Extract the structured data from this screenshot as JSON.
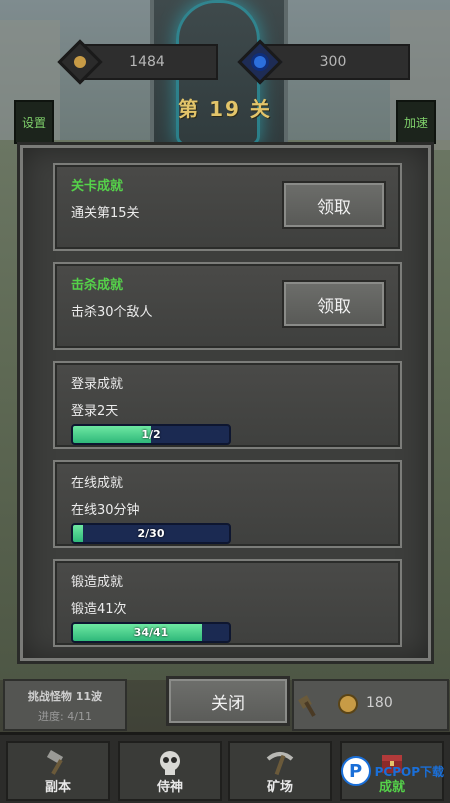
{
  "resources": {
    "gold": "1484",
    "gems": "300"
  },
  "stage": {
    "title": "第 19 关"
  },
  "buttons": {
    "settings": "设置",
    "speed": "加速",
    "close": "关闭"
  },
  "achievements": [
    {
      "title": "关卡成就",
      "desc": "通关第15关",
      "completed": true,
      "action": "领取"
    },
    {
      "title": "击杀成就",
      "desc": "击杀30个敌人",
      "completed": true,
      "action": "领取"
    },
    {
      "title": "登录成就",
      "desc": "登录2天",
      "completed": false,
      "progress_text": "1/2",
      "progress": 0.5
    },
    {
      "title": "在线成就",
      "desc": "在线30分钟",
      "completed": false,
      "progress_text": "2/30",
      "progress": 0.0667
    },
    {
      "title": "锻造成就",
      "desc": "锻造41次",
      "completed": false,
      "progress_text": "34/41",
      "progress": 0.829
    }
  ],
  "challenge": {
    "title": "挑战怪物 11波",
    "progress": "进度: 4/11"
  },
  "forge": {
    "cost": "180"
  },
  "nav": [
    {
      "label": "副本",
      "icon": "hammer-icon"
    },
    {
      "label": "侍神",
      "icon": "skull-icon"
    },
    {
      "label": "矿场",
      "icon": "pickaxe-icon"
    },
    {
      "label": "成就",
      "icon": "chest-icon",
      "active": true
    }
  ],
  "watermark": {
    "brand": "PCPOP下载",
    "sub": "PCPOP"
  },
  "colors": {
    "completed_title": "#55d24a",
    "stage_title": "#e3c56a",
    "progress_fill": "#2fb87a",
    "progress_track": "#1b2a52"
  }
}
